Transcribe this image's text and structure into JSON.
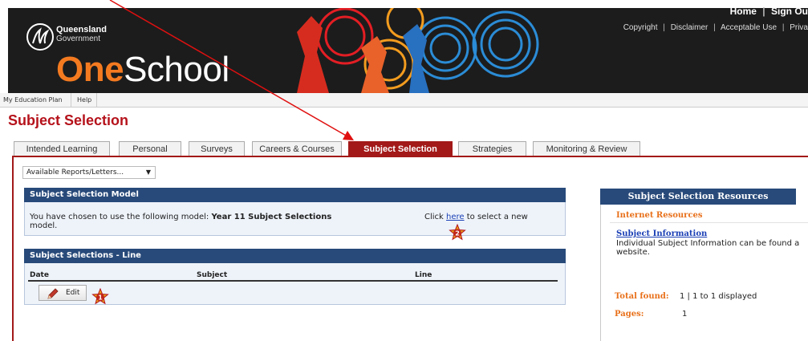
{
  "header": {
    "gov_name_line1": "Queensland",
    "gov_name_line2": "Government",
    "brand_one": "One",
    "brand_school": "School",
    "links": {
      "home": "Home",
      "sep": "|",
      "sign_out": "Sign Ou"
    },
    "legal": {
      "copyright": "Copyright",
      "disclaimer": "Disclaimer",
      "acceptable_use": "Acceptable Use",
      "privacy": "Priva",
      "sep": "|"
    }
  },
  "menu": {
    "items": [
      "My Education Plan",
      "Help"
    ]
  },
  "page": {
    "title": "Subject Selection"
  },
  "tabs": [
    {
      "label": "Intended Learning"
    },
    {
      "label": "Personal"
    },
    {
      "label": "Surveys"
    },
    {
      "label": "Careers & Courses"
    },
    {
      "label": "Subject Selection",
      "active": true
    },
    {
      "label": "Strategies"
    },
    {
      "label": "Monitoring & Review"
    }
  ],
  "reports": {
    "selected": "Available Reports/Letters...",
    "arrow": "▼"
  },
  "model_panel": {
    "title": "Subject Selection Model",
    "text_prefix": "You have chosen to use the following model: ",
    "model_name": "Year 11 Subject Selections",
    "text_suffix": "model.",
    "click_prefix": "Click ",
    "link_text": "here",
    "click_suffix": " to select a new"
  },
  "lines_panel": {
    "title": "Subject Selections - Line",
    "columns": [
      "Date",
      "Subject",
      "Line"
    ],
    "edit_label": "Edit"
  },
  "resources": {
    "title": "Subject Selection Resources",
    "subtitle": "Internet Resources",
    "link_title": "Subject Information",
    "description_line1": "Individual Subject Information can be found a",
    "description_line2": "website.",
    "total_found_label": "Total found:",
    "total_found_value": "1 | 1 to 1 displayed",
    "pages_label": "Pages:",
    "pages_value": "1"
  },
  "badges": {
    "edit": "1",
    "link": "2"
  },
  "colors": {
    "brand_orange": "#f47a20",
    "tab_active": "#a31919",
    "panel_header": "#284a7a",
    "title_red": "#b5121b",
    "accent_orange": "#e8701a",
    "arrow_red": "#e01010"
  }
}
